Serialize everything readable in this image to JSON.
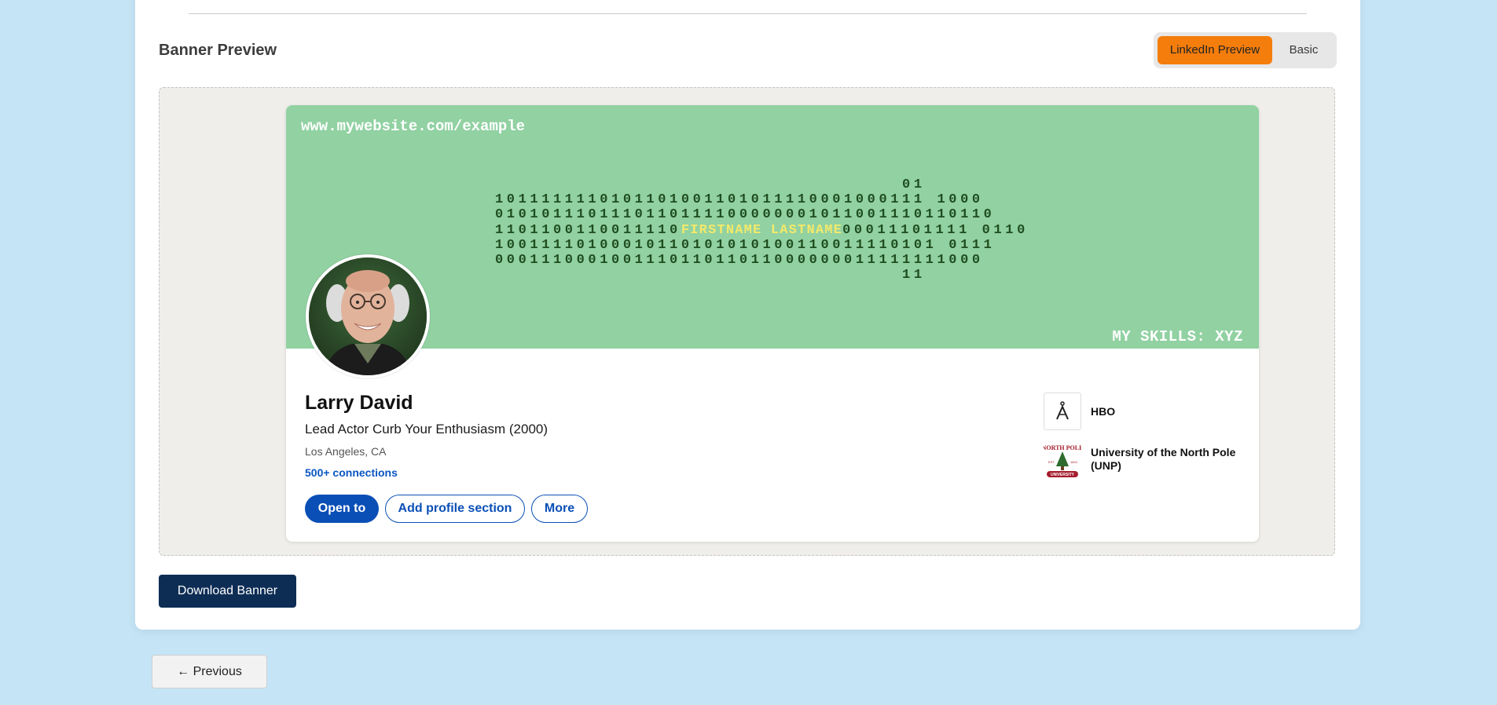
{
  "section": {
    "title": "Banner Preview"
  },
  "toggle": {
    "active_label": "LinkedIn Preview",
    "basic_label": "Basic"
  },
  "banner": {
    "url": "www.mywebsite.com/example",
    "skills": "MY SKILLS: XYZ",
    "bg_color": "#91d1a2",
    "binary_lines": [
      "                                   01",
      "1011111110101101001101011110001000111 1000",
      "0101011101110110111100000001011001110110110",
      "1101100110011110",
      "10011110100010110101010100110011110101 0111",
      "000111000100111011011011000000011111111000",
      "                                   11"
    ],
    "binary_row4_suffix": "00011101111 0110",
    "highlight_text": "FIRSTNAME LASTNAME"
  },
  "profile": {
    "name": "Larry David",
    "headline": "Lead Actor Curb Your Enthusiasm (2000)",
    "location": "Los Angeles, CA",
    "connections": "500+ connections"
  },
  "actions": {
    "open_to": "Open to",
    "add_section": "Add profile section",
    "more": "More"
  },
  "orgs": [
    {
      "name": "HBO",
      "icon": "hbo-logo-icon"
    },
    {
      "name": "University of the North Pole (UNP)",
      "icon": "north-pole-university-logo-icon",
      "logo_text_top": "NORTH POLE",
      "logo_text_mid_left": "EST",
      "logo_text_mid_right": "1824",
      "logo_text_bottom": "UNIVERSITY"
    }
  ],
  "footer": {
    "download_label": "Download Banner",
    "previous_label": "← Previous"
  },
  "colors": {
    "accent_orange": "#f47d0c",
    "linkedin_blue": "#0a4fb6",
    "download_navy": "#0e2d55",
    "page_bg": "#c5e5f7"
  }
}
